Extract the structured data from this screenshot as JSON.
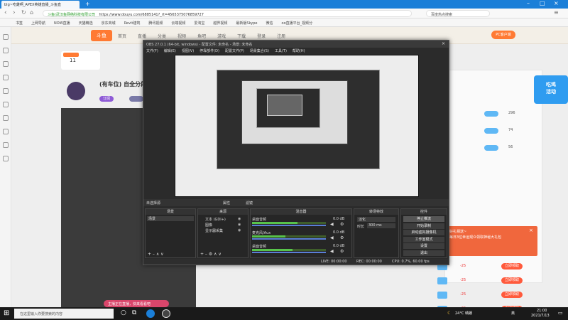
{
  "browser": {
    "tab_title": "blg~吃雞啊_APEX英雄直播_斗鱼直",
    "new_tab": "+",
    "url_prefix": "斗鱼(武汉鱼网络科技有限公司",
    "url": "https://www.douyu.com/6885141?_rt=4565375076859727",
    "search_text": "百度热点搜索",
    "bookmarks": [
      "书签",
      "上网导航",
      "NOW直播",
      "天猫精选",
      "京东商城",
      "Revit建筑",
      "腾讯视频",
      "云端视频",
      "爱淘宝",
      "越界视频",
      "最新版Skype",
      "微信",
      "oo直播平台_视频分"
    ]
  },
  "douyu": {
    "nav": [
      "首页",
      "直播",
      "分类",
      "视频",
      "鱼吧",
      "游戏",
      "下载",
      "登录",
      "注册"
    ],
    "streamer_title": "(有车位) 自全分段吃",
    "follow_label": "订阅",
    "count_label": "11",
    "ad_rows": [
      {
        "tag": "-25",
        "btn": "立即领取"
      },
      {
        "tag": "-25",
        "btn": "立即领取"
      },
      {
        "tag": "-25",
        "btn": "立即领取"
      },
      {
        "tag": "-25",
        "btn": "立即领取"
      }
    ],
    "ranks": [
      {
        "name": "...",
        "value": "296"
      },
      {
        "name": "...",
        "value": "74"
      },
      {
        "name": "...",
        "value": "56"
      }
    ],
    "popup_title": "好礼相送~",
    "popup_text": "每日3位幸运观众领取神秘大礼包",
    "chat_tip": "主播正在直播，快来加入吧",
    "right_btn": "PC客户端"
  },
  "obs": {
    "title": "OBS 27.0.1 (64-bit, windows) - 配置文件: 未命名 - 场景: 未命名",
    "menu": [
      "文件(F)",
      "编辑(E)",
      "视图(V)",
      "停靠部件(D)",
      "配置文件(P)",
      "场景集合(S)",
      "工具(T)",
      "帮助(H)"
    ],
    "no_source": "未选择源",
    "props_label": "属性",
    "filters_label": "滤镜",
    "panels": {
      "scenes": "场景",
      "sources": "来源",
      "mixer": "混音器",
      "transitions": "转场特效",
      "controls": "控件"
    },
    "scene_items": [
      "场景"
    ],
    "source_items": [
      "文本 (GDI+)",
      "图像",
      "显示器采集"
    ],
    "mixer_channels": [
      {
        "name": "桌面音频",
        "db": "0.0 dB",
        "level": 0.62
      },
      {
        "name": "麦克风/Aux",
        "db": "0.0 dB",
        "level": 0.45
      },
      {
        "name": "桌面音频",
        "db": "0.0 dB",
        "level": 0.55
      }
    ],
    "transition_type": "淡化",
    "duration_label": "时长",
    "duration_value": "300 ms",
    "control_buttons": [
      "停止推流",
      "开始录制",
      "启动虚拟摄像机",
      "工作室模式",
      "设置",
      "退出"
    ],
    "status": {
      "live": "LIVE: 00:00:00",
      "rec": "REC: 00:00:00",
      "cpu": "CPU: 0.7%, 60.00 fps"
    }
  },
  "taskbar": {
    "search_placeholder": "在这里输入你要搜索的内容",
    "weather": "24°C 晴朗",
    "time": "21:00",
    "date": "2021/7/13",
    "lang": "英"
  },
  "notification": "主播正在直播，快来看看吧",
  "colors": {
    "accent": "#1b7fd8",
    "douyu_orange": "#ff7a33",
    "obs_bg": "#2b2b2b"
  }
}
